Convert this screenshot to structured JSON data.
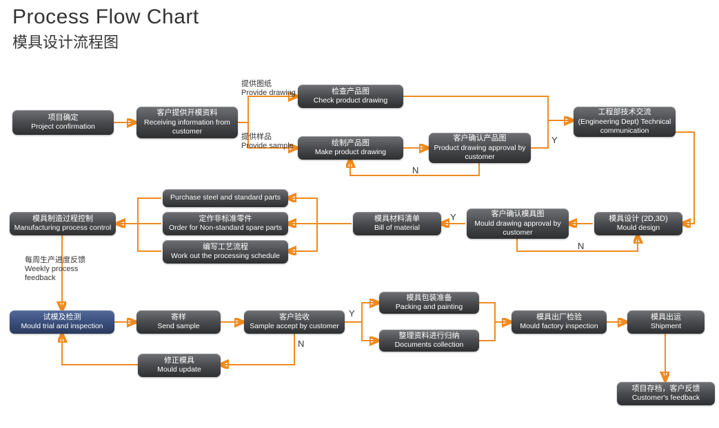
{
  "title": {
    "en": "Process Flow Chart",
    "cn": "模具设计流程图"
  },
  "annotations": {
    "provide_drawing": {
      "cn": "提供图纸",
      "en": "Provide drawing"
    },
    "provide_sample": {
      "cn": "提供样品",
      "en": "Provide sample"
    },
    "weekly_feedback": {
      "cn": "每周生产进度反馈",
      "en": "Weekly process feedback"
    }
  },
  "yn": {
    "y": "Y",
    "n": "N"
  },
  "nodes": {
    "project_confirmation": {
      "cn": "项目确定",
      "en": "Project confirmation"
    },
    "receiving_info": {
      "cn": "客户提供开模资料",
      "en": "Receiving information from customer"
    },
    "check_drawing": {
      "cn": "检查产品图",
      "en": "Check product drawing"
    },
    "make_drawing": {
      "cn": "绘制产品图",
      "en": "Make product drawing"
    },
    "drawing_approval": {
      "cn": "客户确认产品图",
      "en": "Product drawing approval by customer"
    },
    "tech_comm": {
      "cn": "工程部技术交流",
      "en": "(Engineering Dept) Technical communication"
    },
    "mould_design": {
      "cn": "模具设计 (2D,3D)",
      "en": "Mould design"
    },
    "mould_drawing_approval": {
      "cn": "客户确认模具图",
      "en": "Mould drawing approval by customer"
    },
    "bom": {
      "cn": "模具材料清单",
      "en": "Bill of material"
    },
    "purchase_steel": {
      "cn": "",
      "en": "Purchase steel and standard parts"
    },
    "order_nonstd": {
      "cn": "定作非标准零件",
      "en": "Order for Non-standard spare parts"
    },
    "work_out_schedule": {
      "cn": "编写工艺流程",
      "en": "Work out the processing schedule"
    },
    "mfg_control": {
      "cn": "模具制造过程控制",
      "en": "Manufacturing process control"
    },
    "trial_inspection": {
      "cn": "试模及检测",
      "en": "Mould trial and inspection"
    },
    "send_sample": {
      "cn": "寄样",
      "en": "Send sample"
    },
    "sample_accept": {
      "cn": "客户验收",
      "en": "Sample accept by customer"
    },
    "mould_update": {
      "cn": "修正模具",
      "en": "Mould update"
    },
    "packing": {
      "cn": "模具包装准备",
      "en": "Packing and painting"
    },
    "documents": {
      "cn": "整理资料进行归纳",
      "en": "Documents collection"
    },
    "factory_inspection": {
      "cn": "模具出厂检验",
      "en": "Mould factory inspection"
    },
    "shipment": {
      "cn": "模具出运",
      "en": "Shipment"
    },
    "customer_feedback": {
      "cn": "项目存档，客户反馈",
      "en": "Customer's feedback"
    }
  }
}
